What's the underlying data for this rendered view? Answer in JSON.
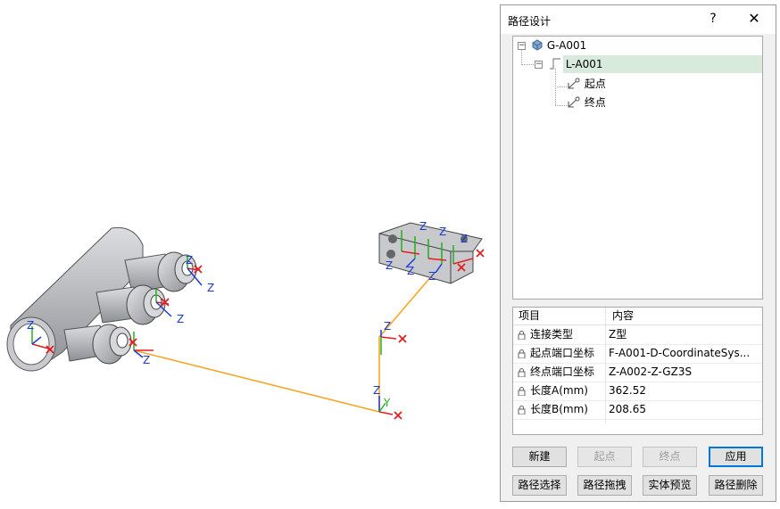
{
  "dialog": {
    "title": "路径设计",
    "help": "?",
    "close": "✕"
  },
  "tree": {
    "root": {
      "label": "G-A001",
      "expander": "−",
      "icon": "pipe-group-icon"
    },
    "line": {
      "label": "L-A001",
      "expander": "−",
      "icon": "route-line-icon"
    },
    "points": [
      {
        "label": "起点",
        "icon": "point-icon"
      },
      {
        "label": "终点",
        "icon": "point-icon"
      }
    ]
  },
  "props": {
    "headers": {
      "item": "项目",
      "content": "内容"
    },
    "rows": [
      {
        "key": "连接类型",
        "value": "Z型"
      },
      {
        "key": "起点端口坐标",
        "value": "F-A001-D-CoordinateSys..."
      },
      {
        "key": "终点端口坐标",
        "value": "Z-A002-Z-GZ3S"
      },
      {
        "key": "长度A(mm)",
        "value": "362.52"
      },
      {
        "key": "长度B(mm)",
        "value": "208.65"
      }
    ]
  },
  "buttons": {
    "new": "新建",
    "start": "起点",
    "end": "终点",
    "apply": "应用",
    "select": "路径选择",
    "drag": "路径拖拽",
    "preview": "实体预览",
    "delete": "路径删除"
  },
  "viewport": {
    "axis_label": "Z",
    "axis_label_y": "Y",
    "colors": {
      "route": "#f5a623",
      "x_axis": "#e02020",
      "y_axis": "#22b022",
      "z_axis": "#1a3ad8",
      "steel": "#c4c6ca"
    }
  }
}
